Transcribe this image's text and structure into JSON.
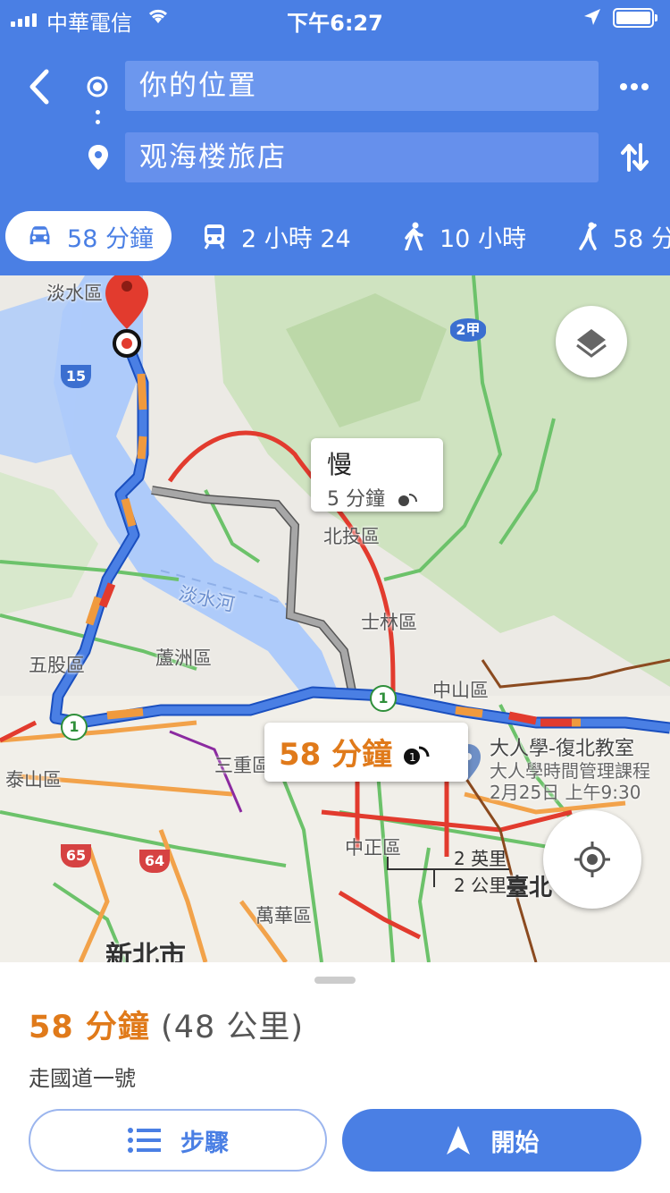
{
  "status_bar": {
    "carrier": "中華電信",
    "time": "下午6:27"
  },
  "search": {
    "origin": "你的位置",
    "destination": "观海楼旅店"
  },
  "modes": [
    {
      "id": "drive",
      "label": "58 分鐘",
      "icon": "car-icon",
      "selected": true
    },
    {
      "id": "transit",
      "label": "2 小時 24",
      "icon": "train-icon"
    },
    {
      "id": "walk",
      "label": "10 小時",
      "icon": "walking-icon"
    },
    {
      "id": "ride",
      "label": "58 分",
      "icon": "ride-hail-icon"
    }
  ],
  "map": {
    "labels": {
      "tamsui": "淡水區",
      "beitou": "北投區",
      "tamsui_river": "淡水河",
      "shilin": "士林區",
      "wugu": "五股區",
      "luzhou": "蘆洲區",
      "zhongshan": "中山區",
      "sanchong": "三重區",
      "taishan": "泰山區",
      "zhongzheng": "中正區",
      "wanhua": "萬華區",
      "new_taipei": "新北市",
      "taipei": "臺北"
    },
    "poi": {
      "name": "大人學-復北教室",
      "subtitle": "大人學時間管理課程",
      "event": "2月25日 上午9:30"
    },
    "shields": [
      "15",
      "2甲",
      "65",
      "64",
      "1",
      "1",
      "1"
    ],
    "slow_callout": {
      "title": "慢",
      "delay": "5 分鐘"
    },
    "route_callout": {
      "eta": "58 分鐘"
    },
    "scale": {
      "imperial": "2 英里",
      "metric": "2 公里"
    },
    "colors": {
      "route": "#4a7fe4",
      "alt_route": "#9e9e9e",
      "traffic_slow": "#f09a3e",
      "traffic_jam": "#e23b2e"
    }
  },
  "sheet": {
    "eta": "58 分鐘",
    "distance": "(48 公里)",
    "via": "走國道一號",
    "steps_label": "步驟",
    "start_label": "開始"
  }
}
